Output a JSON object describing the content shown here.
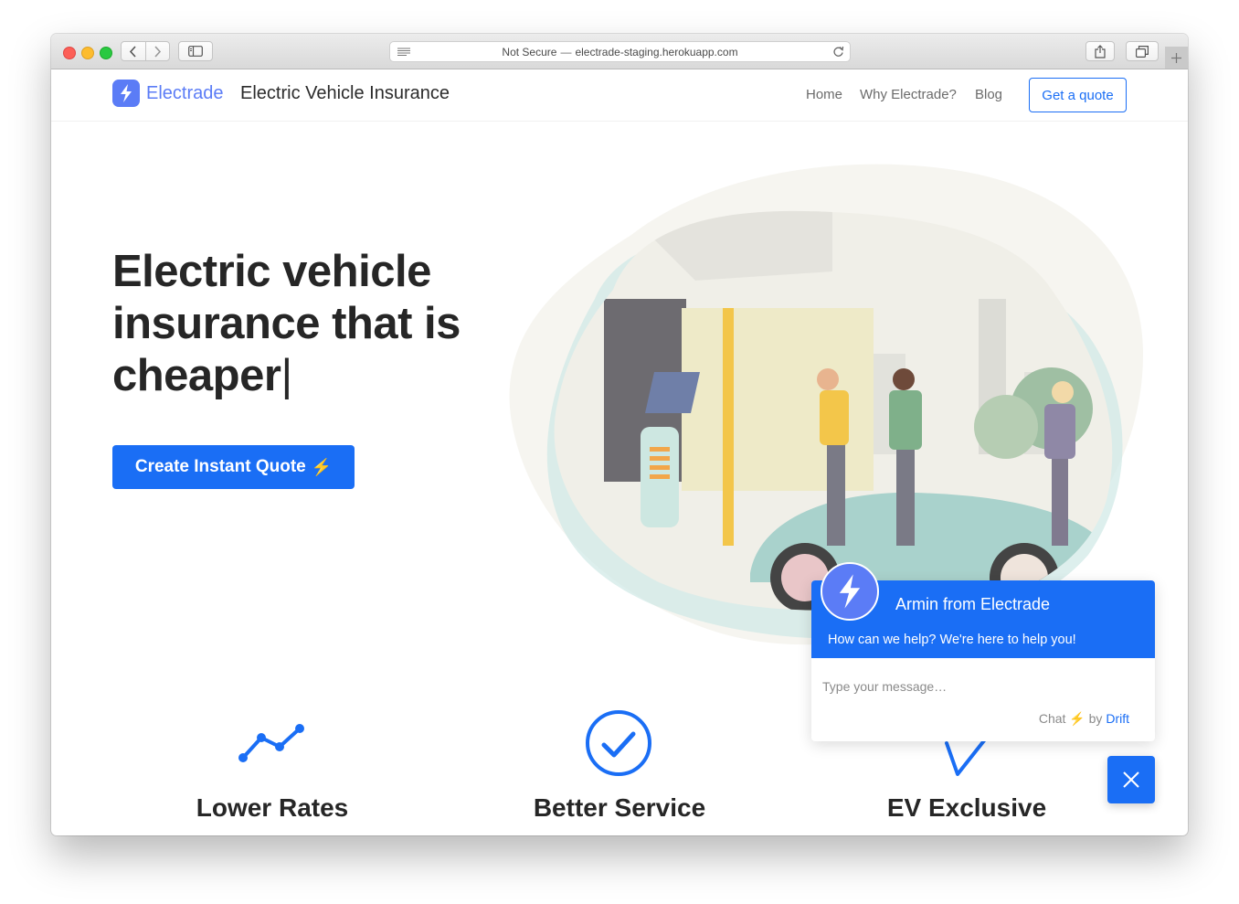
{
  "browser": {
    "url_security": "Not Secure",
    "url_separator": "—",
    "url_host": "electrade-staging.herokuapp.com"
  },
  "header": {
    "brand": "Electrade",
    "tagline": "Electric Vehicle Insurance",
    "nav": [
      "Home",
      "Why Electrade?",
      "Blog"
    ],
    "cta": "Get a quote",
    "accent_color": "#5b7cf6",
    "primary_color": "#1a6ef5"
  },
  "hero": {
    "title": "Electric vehicle insurance that is cheaper",
    "cursor": "|",
    "cta_label": "Create Instant Quote",
    "cta_icon": "⚡"
  },
  "features": [
    {
      "title": "Lower Rates",
      "icon": "trend-line-icon"
    },
    {
      "title": "Better Service",
      "icon": "check-circle-icon"
    },
    {
      "title": "EV Exclusive",
      "icon": "lightning-icon"
    }
  ],
  "chat": {
    "agent_name": "Armin from Electrade",
    "subtitle": "How can we help? We're here to help you!",
    "placeholder": "Type your message…",
    "credit_prefix": "Chat",
    "credit_icon": "⚡",
    "credit_by": "by",
    "credit_brand": "Drift"
  }
}
